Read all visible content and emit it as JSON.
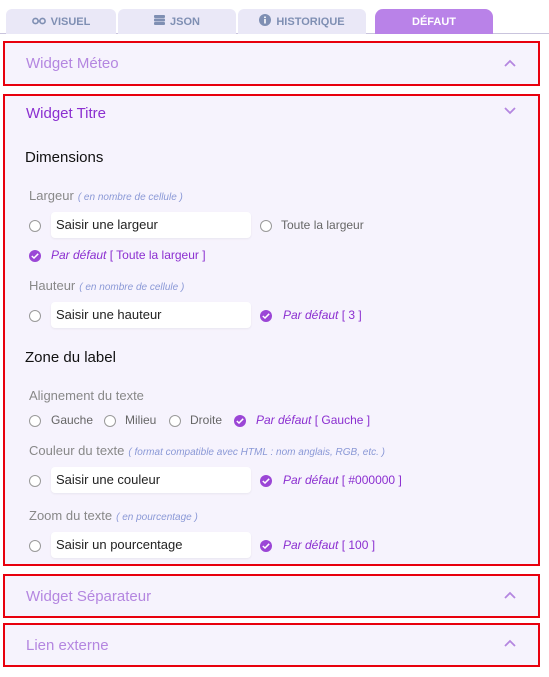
{
  "tabs": [
    {
      "label": "VISUEL",
      "icon": "eye-icon"
    },
    {
      "label": "JSON",
      "icon": "database-icon"
    },
    {
      "label": "HISTORIQUE",
      "icon": "info-icon"
    },
    {
      "label": "DÉFAUT",
      "active": true
    }
  ],
  "colors": {
    "accent": "#8b2fd0",
    "active_tab": "#b982e8",
    "highlight_border": "#e8000d",
    "panel_bg": "#f6f3fd"
  },
  "panels": {
    "meteo": {
      "title": "Widget Méteo"
    },
    "titre": {
      "title": "Widget Titre",
      "dimensions": {
        "heading": "Dimensions",
        "largeur": {
          "label": "Largeur",
          "hint": "( en nombre de cellule )",
          "placeholder": "Saisir une largeur",
          "option_full": "Toute la largeur",
          "default_label": "Par défaut",
          "default_value": "[ Toute la largeur ]"
        },
        "hauteur": {
          "label": "Hauteur",
          "hint": "( en nombre de cellule )",
          "placeholder": "Saisir une hauteur",
          "default_label": "Par défaut",
          "default_value": "[ 3 ]"
        }
      },
      "zone_label": {
        "heading": "Zone du label",
        "alignement": {
          "label": "Alignement du texte",
          "options": [
            "Gauche",
            "Milieu",
            "Droite"
          ],
          "default_label": "Par défaut",
          "default_value": "[ Gauche ]"
        },
        "couleur": {
          "label": "Couleur du texte",
          "hint": "( format compatible avec HTML : nom anglais, RGB, etc. )",
          "placeholder": "Saisir une couleur",
          "default_label": "Par défaut",
          "default_value": "[ #000000 ]"
        },
        "zoom": {
          "label": "Zoom du texte",
          "hint": "( en pourcentage )",
          "placeholder": "Saisir un pourcentage",
          "default_label": "Par défaut",
          "default_value": "[ 100 ]"
        }
      }
    },
    "separateur": {
      "title": "Widget Séparateur"
    },
    "lien": {
      "title": "Lien externe"
    }
  }
}
